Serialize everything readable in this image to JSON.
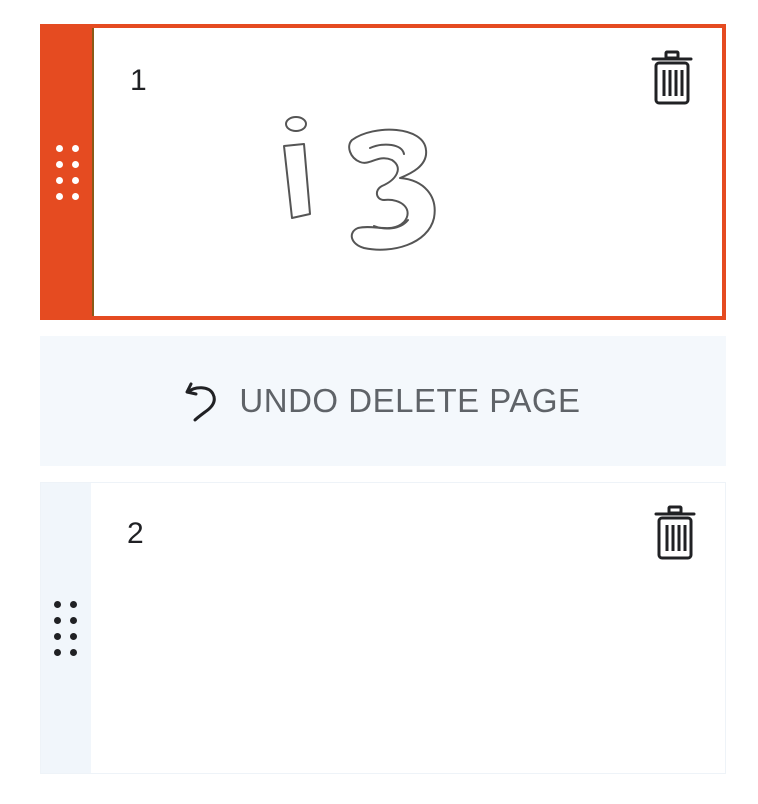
{
  "pages": [
    {
      "number": "1",
      "selected": true
    },
    {
      "number": "2",
      "selected": false
    }
  ],
  "undo": {
    "label": "UNDO DELETE PAGE"
  },
  "colors": {
    "accent": "#e54b21",
    "text": "#202124",
    "muted": "#5f6368",
    "undo_bg": "#f4f8fc"
  },
  "icons": {
    "drag": "drag-handle-icon",
    "delete": "trash-icon",
    "undo": "undo-icon"
  }
}
